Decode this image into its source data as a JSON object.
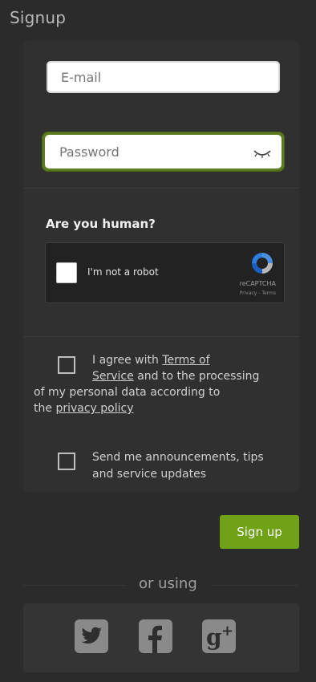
{
  "page": {
    "title": "Signup"
  },
  "form": {
    "email_placeholder": "E-mail",
    "password_placeholder": "Password"
  },
  "captcha": {
    "heading": "Are you human?",
    "label": "I'm not a robot",
    "brand": "reCAPTCHA",
    "links": "Privacy - Terms"
  },
  "terms": {
    "pre": "I agree with ",
    "link1": "Terms of",
    "link1b": "Service",
    "mid": " and to the processing",
    "line3": "of my personal data according to",
    "pre4": "the ",
    "link2": "privacy policy"
  },
  "newsletter": {
    "text": "Send me announcements, tips and service updates"
  },
  "actions": {
    "signup_label": "Sign up"
  },
  "social": {
    "divider_text": "or using"
  },
  "colors": {
    "accent": "#6fa217",
    "focus_border": "#5c7b1e"
  }
}
